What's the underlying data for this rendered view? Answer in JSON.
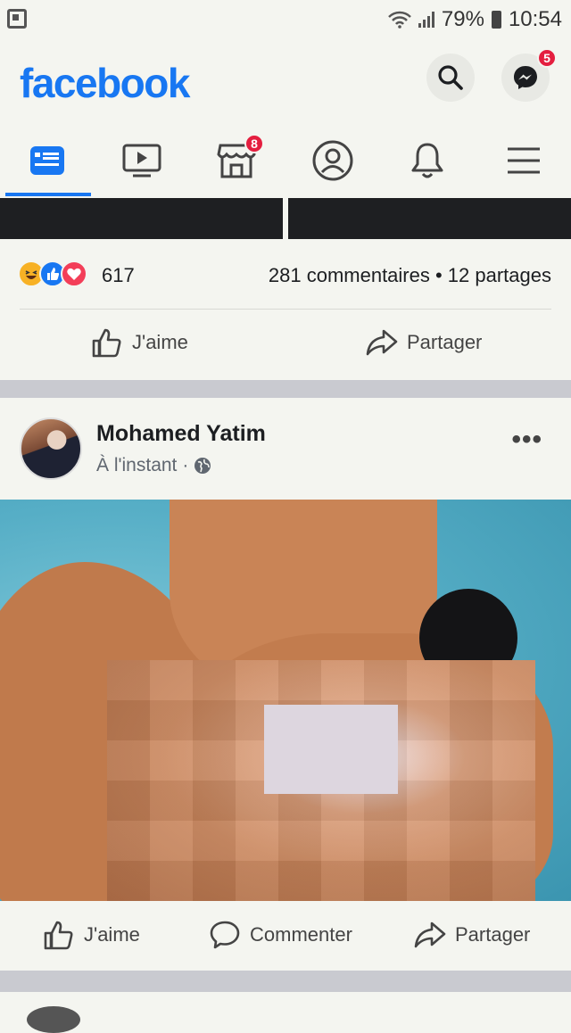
{
  "status_bar": {
    "battery": "79%",
    "time": "10:54"
  },
  "header": {
    "logo": "facebook",
    "messenger_badge": "5"
  },
  "nav": {
    "marketplace_badge": "8"
  },
  "post1": {
    "reaction_count": "617",
    "meta": "281 commentaires • 12 partages",
    "like_label": "J'aime",
    "share_label": "Partager"
  },
  "post2": {
    "author": "Mohamed Yatim",
    "time": "À l'instant",
    "more": "•••",
    "like_label": "J'aime",
    "comment_label": "Commenter",
    "share_label": "Partager"
  },
  "colors": {
    "brand": "#1877f2",
    "badge": "#e41e3f"
  }
}
